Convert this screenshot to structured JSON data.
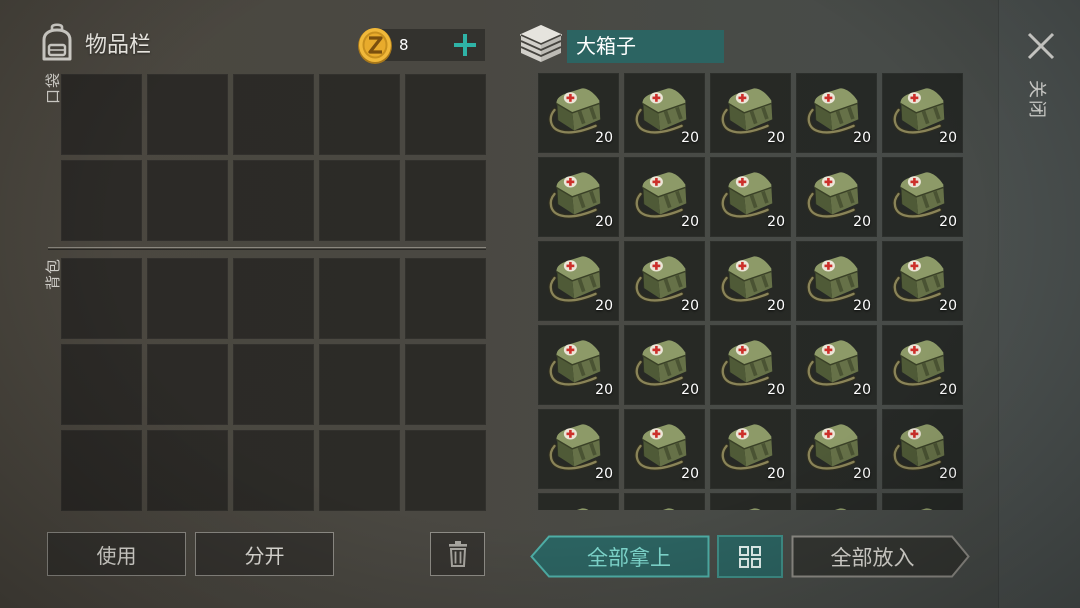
{
  "inventory": {
    "icon": "backpack-icon",
    "title": "物品栏",
    "coins": {
      "icon": "coin-icon",
      "amount": 8,
      "add_icon": "plus-icon"
    },
    "pocket_label": "口袋",
    "backpack_label": "背包",
    "use_label": "使用",
    "split_label": "分开",
    "trash_icon": "trash-icon"
  },
  "container": {
    "icon": "crate-icon",
    "name": "大箱子",
    "items": [
      {
        "icon": "first-aid-bag-icon",
        "count": 20
      },
      {
        "icon": "first-aid-bag-icon",
        "count": 20
      },
      {
        "icon": "first-aid-bag-icon",
        "count": 20
      },
      {
        "icon": "first-aid-bag-icon",
        "count": 20
      },
      {
        "icon": "first-aid-bag-icon",
        "count": 20
      },
      {
        "icon": "first-aid-bag-icon",
        "count": 20
      },
      {
        "icon": "first-aid-bag-icon",
        "count": 20
      },
      {
        "icon": "first-aid-bag-icon",
        "count": 20
      },
      {
        "icon": "first-aid-bag-icon",
        "count": 20
      },
      {
        "icon": "first-aid-bag-icon",
        "count": 20
      },
      {
        "icon": "first-aid-bag-icon",
        "count": 20
      },
      {
        "icon": "first-aid-bag-icon",
        "count": 20
      },
      {
        "icon": "first-aid-bag-icon",
        "count": 20
      },
      {
        "icon": "first-aid-bag-icon",
        "count": 20
      },
      {
        "icon": "first-aid-bag-icon",
        "count": 20
      },
      {
        "icon": "first-aid-bag-icon",
        "count": 20
      },
      {
        "icon": "first-aid-bag-icon",
        "count": 20
      },
      {
        "icon": "first-aid-bag-icon",
        "count": 20
      },
      {
        "icon": "first-aid-bag-icon",
        "count": 20
      },
      {
        "icon": "first-aid-bag-icon",
        "count": 20
      },
      {
        "icon": "first-aid-bag-icon",
        "count": 20
      },
      {
        "icon": "first-aid-bag-icon",
        "count": 20
      },
      {
        "icon": "first-aid-bag-icon",
        "count": 20
      },
      {
        "icon": "first-aid-bag-icon",
        "count": 20
      },
      {
        "icon": "first-aid-bag-icon",
        "count": 20
      },
      {
        "icon": "first-aid-bag-icon"
      },
      {
        "icon": "first-aid-bag-icon"
      },
      {
        "icon": "first-aid-bag-icon"
      },
      {
        "icon": "first-aid-bag-icon"
      },
      {
        "icon": "first-aid-bag-icon"
      }
    ]
  },
  "actions": {
    "take_all": "全部拿上",
    "sort_icon": "grid-icon",
    "put_all": "全部放入"
  },
  "close": {
    "icon": "close-icon",
    "label": "关闭"
  },
  "colors": {
    "accent": "#2c6462",
    "accent_border": "#4fb0a8",
    "accent_text": "#7fd9cf",
    "plus": "#2fb3a6",
    "count_text": "#ffffff",
    "cross": "#cc2f2a"
  }
}
